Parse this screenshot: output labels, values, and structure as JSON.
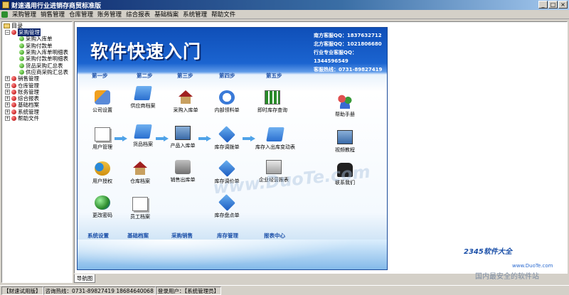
{
  "window": {
    "title": "财速通用行业进销存商贸标准版"
  },
  "menu": [
    "采购管理",
    "销售管理",
    "仓库管理",
    "账务管理",
    "综合报表",
    "基础档案",
    "系统管理",
    "帮助文件"
  ],
  "tree": {
    "root": "目录",
    "nodes": [
      {
        "label": "采购管理",
        "selected": true,
        "children": [
          "采购入库单",
          "采购付款单",
          "采购入库单明细表",
          "采购付款单明细表",
          "货品采购汇总表",
          "供应商采购汇总表"
        ]
      },
      {
        "label": "销售管理"
      },
      {
        "label": "仓库管理"
      },
      {
        "label": "账务管理"
      },
      {
        "label": "综合报表"
      },
      {
        "label": "基础档案"
      },
      {
        "label": "系统管理"
      },
      {
        "label": "帮助文件"
      }
    ]
  },
  "panel": {
    "title": "软件快速入门",
    "contacts": [
      "南方客服QQ：1837632712",
      "北方客服QQ：1021806680",
      "行业专业客服QQ：1344596549",
      "客服热线：0731-89827419"
    ],
    "steps": [
      "第一步",
      "第二步",
      "第三步",
      "第四步",
      "第五步"
    ],
    "tiles": {
      "company": "公司设置",
      "supplier": "供应商档案",
      "purchase_in": "采购入库单",
      "internal": "内部领料单",
      "stock_query": "即时库存查询",
      "help": "帮助手册",
      "user_mgmt": "用户管理",
      "goods": "货品档案",
      "product_in": "产品入库单",
      "transfer": "库存调拨单",
      "inout_detail": "库存入出库变动表",
      "video": "视频教程",
      "user_auth": "用户授权",
      "warehouse": "仓库档案",
      "sales_out": "销售出库单",
      "price_adj": "库存调价单",
      "report": "企业经营报表",
      "contact": "联系我们",
      "password": "更改密码",
      "employee": "员工档案",
      "stocktake": "库存盘点单"
    },
    "bottom_links": [
      "系统设置",
      "基础档案",
      "采购销售",
      "库存管理",
      "报表中心"
    ],
    "watermark": "www.DuoTe.com"
  },
  "tabs": [
    "导航图"
  ],
  "side": {
    "brand": "2345软件大全",
    "url": "www.DuoTe.com",
    "slogan": "国内最安全的软件站"
  },
  "status": {
    "edition": "【财速试用版】",
    "hotline": "咨询热线：0731-89827419 18684640068",
    "login": "登录用户：【系统管理员】"
  }
}
